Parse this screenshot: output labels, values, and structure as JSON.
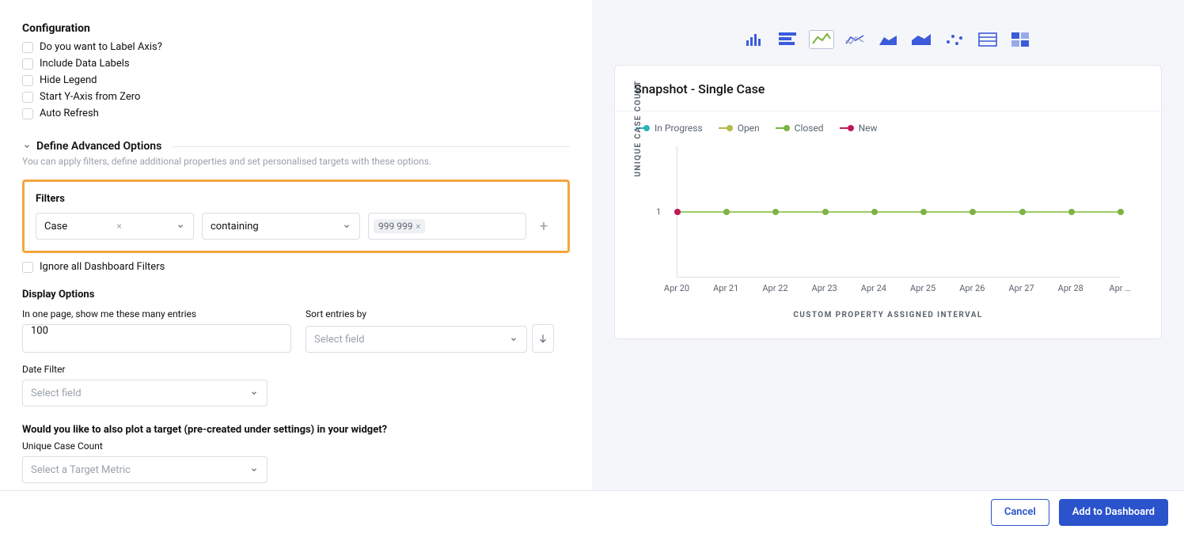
{
  "configuration": {
    "title": "Configuration",
    "items": [
      {
        "label": "Do you want to Label Axis?"
      },
      {
        "label": "Include Data Labels"
      },
      {
        "label": "Hide Legend"
      },
      {
        "label": "Start Y-Axis from Zero"
      },
      {
        "label": "Auto Refresh"
      }
    ]
  },
  "advanced": {
    "title": "Define Advanced Options",
    "subtitle": "You can apply filters, define additional properties and set personalised targets with these options."
  },
  "filters": {
    "title": "Filters",
    "field": "Case",
    "operator": "containing",
    "value_tag": "999 999",
    "ignore_label": "Ignore all Dashboard Filters"
  },
  "display": {
    "title": "Display Options",
    "entries_label": "In one page, show me these many entries",
    "entries_value": "100",
    "sort_label": "Sort entries by",
    "sort_placeholder": "Select field",
    "date_label": "Date Filter",
    "date_placeholder": "Select field"
  },
  "target": {
    "question": "Would you like to also plot a target (pre-created under settings) in your widget?",
    "field_label": "Unique Case Count",
    "placeholder": "Select a Target Metric"
  },
  "chart": {
    "title": "Snapshot - Single Case",
    "legend": {
      "in_progress": "In Progress",
      "open": "Open",
      "closed": "Closed",
      "new": "New"
    },
    "yaxis_title": "UNIQUE CASE COUNT",
    "xaxis_title": "CUSTOM PROPERTY ASSIGNED INTERVAL",
    "ytick": "1"
  },
  "chart_data": {
    "type": "line",
    "title": "Snapshot - Single Case",
    "xlabel": "CUSTOM PROPERTY ASSIGNED INTERVAL",
    "ylabel": "UNIQUE CASE COUNT",
    "categories": [
      "Apr 20",
      "Apr 21",
      "Apr 22",
      "Apr 23",
      "Apr 24",
      "Apr 25",
      "Apr 26",
      "Apr 27",
      "Apr 28",
      "Apr …"
    ],
    "ylim": [
      0,
      2
    ],
    "series": [
      {
        "name": "In Progress",
        "color": "#2bb3c0",
        "values": [
          1,
          1,
          1,
          1,
          1,
          1,
          1,
          1,
          1,
          1
        ]
      },
      {
        "name": "Open",
        "color": "#b2bb4a",
        "values": [
          1,
          1,
          1,
          1,
          1,
          1,
          1,
          1,
          1,
          1
        ]
      },
      {
        "name": "Closed",
        "color": "#7cb342",
        "values": [
          1,
          1,
          1,
          1,
          1,
          1,
          1,
          1,
          1,
          1
        ]
      },
      {
        "name": "New",
        "color": "#c2185b",
        "values": [
          1,
          1,
          1,
          1,
          1,
          1,
          1,
          1,
          1,
          1
        ]
      }
    ]
  },
  "footer": {
    "cancel": "Cancel",
    "add": "Add to Dashboard"
  }
}
